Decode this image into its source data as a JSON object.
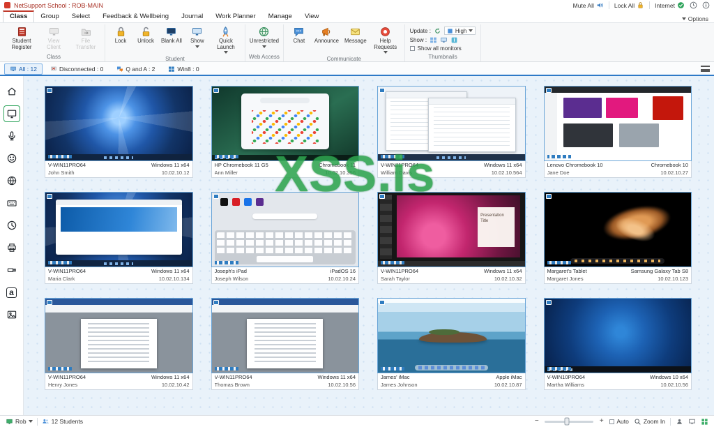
{
  "titlebar": {
    "title": "NetSupport School : ROB-MAIN",
    "mute_all": "Mute All",
    "lock_all": "Lock All",
    "internet": "Internet",
    "options": "Options"
  },
  "menubar": {
    "items": [
      "Class",
      "Group",
      "Select",
      "Feedback & Wellbeing",
      "Journal",
      "Work Planner",
      "Manage",
      "View"
    ]
  },
  "ribbon": {
    "class_group": {
      "label": "Class",
      "student_register": "Student Register",
      "view_client": "View Client",
      "file_transfer": "File Transfer"
    },
    "student_group": {
      "label": "Student",
      "lock": "Lock",
      "unlock": "Unlock",
      "blank_all": "Blank All",
      "show": "Show",
      "quick_launch": "Quick Launch"
    },
    "web_group": {
      "label": "Web Access",
      "unrestricted": "Unrestricted"
    },
    "comm_group": {
      "label": "Communicate",
      "chat": "Chat",
      "announce": "Announce",
      "message": "Message",
      "help_requests": "Help Requests"
    },
    "thumb_group": {
      "label": "Thumbnails",
      "update": "Update :",
      "show": "Show :",
      "quality": "High",
      "show_all_monitors": "Show all monitors"
    }
  },
  "tabs": {
    "all": "All : 12",
    "disconnected": "Disconnected : 0",
    "qa": "Q and A : 2",
    "win8": "Win8 : 0"
  },
  "sidebar": {
    "icons": [
      "home",
      "thumbnails",
      "audio",
      "wellbeing",
      "web-control",
      "surveys",
      "lesson-timer",
      "print",
      "devices",
      "applications",
      "whiteboard"
    ],
    "app_glyph": "a"
  },
  "watermark": "XSS.is",
  "thumbnails": [
    {
      "machine": "V-WIN11PRO64",
      "user": "John Smith",
      "os": "Windows 11 x64",
      "ip": "10.02.10.12"
    },
    {
      "machine": "HP Chromebook 11 G5",
      "user": "Ann Miller",
      "os": "Chromebook 11",
      "ip": "10.02.10.356"
    },
    {
      "machine": "V-WIN11PRO64",
      "user": "William Davis",
      "os": "Windows 11 x64",
      "ip": "10.02.10.564"
    },
    {
      "machine": "Lenovo Chromebook 10",
      "user": "Jane Doe",
      "os": "Chromebook 10",
      "ip": "10.02.10.27"
    },
    {
      "machine": "V-WIN11PRO64",
      "user": "Maria Clark",
      "os": "Windows 11 x64",
      "ip": "10.02.10.134"
    },
    {
      "machine": "Joseph's iPad",
      "user": "Joseph Wilson",
      "os": "iPadOS 16",
      "ip": "10.02.10.24"
    },
    {
      "machine": "V-WIN11PRO64",
      "user": "Sarah Taylor",
      "os": "Windows 11 x64",
      "ip": "10.02.10.32",
      "slide_title": "Presentation Title"
    },
    {
      "machine": "Margaret's Tablet",
      "user": "Margaret Jones",
      "os": "Samsung Galaxy Tab S8",
      "ip": "10.02.10.123"
    },
    {
      "machine": "V-WIN11PRO64",
      "user": "Henry Jones",
      "os": "Windows 11 x64",
      "ip": "10.02.10.42"
    },
    {
      "machine": "V-WIN11PRO64",
      "user": "Thomas Brown",
      "os": "Windows 11 x64",
      "ip": "10.02.10.56"
    },
    {
      "machine": "James' iMac",
      "user": "James Johnson",
      "os": "Apple iMac",
      "ip": "10.02.10.87"
    },
    {
      "machine": "V-WIN10PRO64",
      "user": "Martha Williams",
      "os": "Windows 10 x64",
      "ip": "10.02.10.56"
    }
  ],
  "statusbar": {
    "user": "Rob",
    "students": "12 Students",
    "auto": "Auto",
    "zoom_in": "Zoom In"
  },
  "colors": {
    "accent_blue": "#2e79c7",
    "selected_green": "#2fa45c",
    "watermark_green": "#2ea44f",
    "brand_red": "#a93226"
  }
}
